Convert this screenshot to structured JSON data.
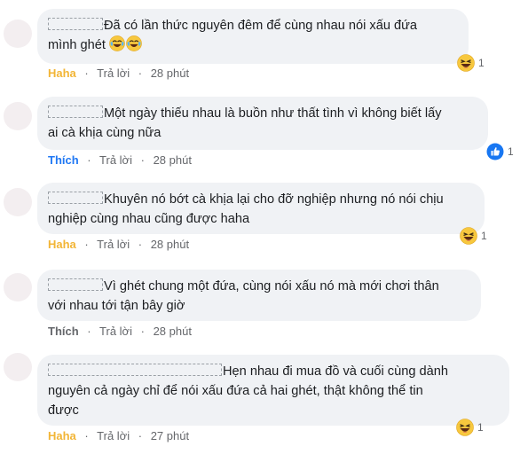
{
  "comments": [
    {
      "text": "Đã có lần thức nguyên đêm để cùng nhau nói xấu đứa mình ghét",
      "text_line1": "Đã có lần thức nguyên đêm để cùng nhau nói xấu đứa",
      "text_line2": "mình ghét",
      "emojis": [
        "laughing-crying-emoji",
        "laughing-crying-emoji"
      ],
      "reaction_label": "Haha",
      "reply_label": "Trả lời",
      "time": "28 phút",
      "reaction_count": "1",
      "reaction_icon": "haha-icon"
    },
    {
      "text_line1": "Một ngày thiếu nhau là buồn như thất tình vì không biết lấy",
      "text_line2": "ai cà khịa cùng nữa",
      "reaction_label": "Thích",
      "reply_label": "Trả lời",
      "time": "28 phút",
      "reaction_count": "1",
      "reaction_icon": "like-icon"
    },
    {
      "text_line1": "Khuyên nó bớt cà khịa lại cho đỡ nghiệp nhưng nó nói chịu",
      "text_line2": "nghiệp cùng nhau cũng được haha",
      "reaction_label": "Haha",
      "reply_label": "Trả lời",
      "time": "28 phút",
      "reaction_count": "1",
      "reaction_icon": "haha-icon"
    },
    {
      "text_line1": "Vì ghét chung một đứa, cùng nói xấu nó mà mới chơi thân",
      "text_line2": "với nhau tới tận bây giờ",
      "reaction_label": "Thích",
      "reply_label": "Trả lời",
      "time": "28 phút"
    },
    {
      "text_line1": "Hẹn nhau đi mua đồ và cuối cùng dành",
      "text_line2": "nguyên cả ngày chỉ để nói xấu đứa cả hai ghét, thật không thể tin",
      "text_line3": "được",
      "reaction_label": "Haha",
      "reply_label": "Trả lời",
      "time": "27 phút",
      "reaction_count": "1",
      "reaction_icon": "haha-icon"
    }
  ],
  "colors": {
    "bubble": "#f0f2f5",
    "haha": "#f2b536",
    "like": "#2078f4",
    "meta": "#65676b",
    "text": "#1c1e21"
  }
}
